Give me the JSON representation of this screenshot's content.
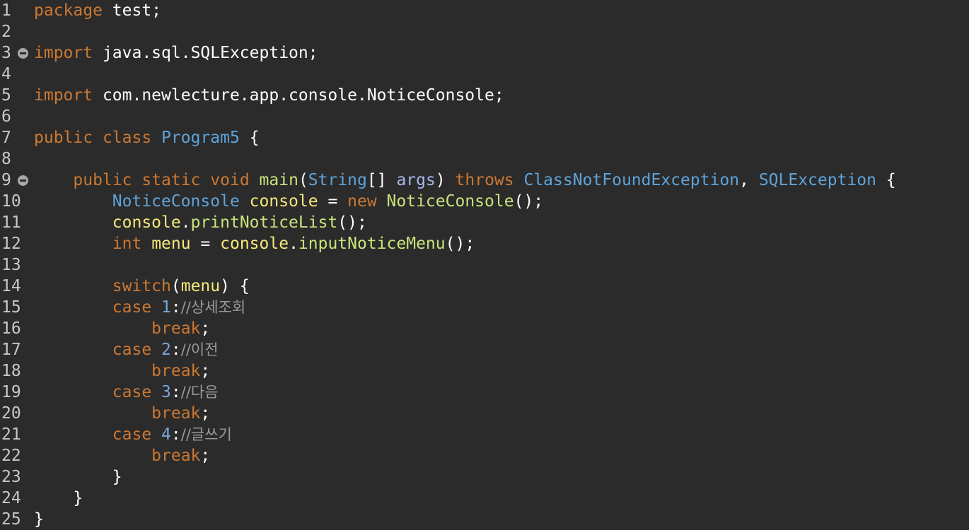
{
  "editor": {
    "lines": [
      {
        "num": "1",
        "fold": false,
        "tokens": [
          {
            "t": "package",
            "c": "kw"
          },
          {
            "t": " test;",
            "c": "plain"
          }
        ]
      },
      {
        "num": "2",
        "fold": false,
        "tokens": []
      },
      {
        "num": "3",
        "fold": true,
        "tokens": [
          {
            "t": "import",
            "c": "kw"
          },
          {
            "t": " java.sql.SQLException;",
            "c": "plain"
          }
        ]
      },
      {
        "num": "4",
        "fold": false,
        "tokens": []
      },
      {
        "num": "5",
        "fold": false,
        "tokens": [
          {
            "t": "import",
            "c": "kw"
          },
          {
            "t": " com.newlecture.app.console.NoticeConsole;",
            "c": "plain"
          }
        ]
      },
      {
        "num": "6",
        "fold": false,
        "tokens": []
      },
      {
        "num": "7",
        "fold": false,
        "tokens": [
          {
            "t": "public",
            "c": "kw"
          },
          {
            "t": " ",
            "c": "plain"
          },
          {
            "t": "class",
            "c": "kw"
          },
          {
            "t": " ",
            "c": "plain"
          },
          {
            "t": "Program5",
            "c": "type"
          },
          {
            "t": " {",
            "c": "plain"
          }
        ]
      },
      {
        "num": "8",
        "fold": false,
        "tokens": []
      },
      {
        "num": "9",
        "fold": true,
        "tokens": [
          {
            "t": "    ",
            "c": "plain"
          },
          {
            "t": "public",
            "c": "kw"
          },
          {
            "t": " ",
            "c": "plain"
          },
          {
            "t": "static",
            "c": "kw"
          },
          {
            "t": " ",
            "c": "plain"
          },
          {
            "t": "void",
            "c": "kw"
          },
          {
            "t": " ",
            "c": "plain"
          },
          {
            "t": "main",
            "c": "fn"
          },
          {
            "t": "(",
            "c": "plain"
          },
          {
            "t": "String",
            "c": "type"
          },
          {
            "t": "[] ",
            "c": "plain"
          },
          {
            "t": "args",
            "c": "param"
          },
          {
            "t": ") ",
            "c": "plain"
          },
          {
            "t": "throws",
            "c": "kw"
          },
          {
            "t": " ",
            "c": "plain"
          },
          {
            "t": "ClassNotFoundException",
            "c": "type"
          },
          {
            "t": ", ",
            "c": "plain"
          },
          {
            "t": "SQLException",
            "c": "type"
          },
          {
            "t": " {",
            "c": "plain"
          }
        ]
      },
      {
        "num": "10",
        "fold": false,
        "tokens": [
          {
            "t": "        ",
            "c": "plain"
          },
          {
            "t": "NoticeConsole",
            "c": "type"
          },
          {
            "t": " ",
            "c": "plain"
          },
          {
            "t": "console",
            "c": "var"
          },
          {
            "t": " = ",
            "c": "plain"
          },
          {
            "t": "new",
            "c": "kw"
          },
          {
            "t": " ",
            "c": "plain"
          },
          {
            "t": "NoticeConsole",
            "c": "fn"
          },
          {
            "t": "();",
            "c": "plain"
          }
        ]
      },
      {
        "num": "11",
        "fold": false,
        "tokens": [
          {
            "t": "        ",
            "c": "plain"
          },
          {
            "t": "console",
            "c": "var"
          },
          {
            "t": ".",
            "c": "plain"
          },
          {
            "t": "printNoticeList",
            "c": "fn"
          },
          {
            "t": "();",
            "c": "plain"
          }
        ]
      },
      {
        "num": "12",
        "fold": false,
        "tokens": [
          {
            "t": "        ",
            "c": "plain"
          },
          {
            "t": "int",
            "c": "kw"
          },
          {
            "t": " ",
            "c": "plain"
          },
          {
            "t": "menu",
            "c": "var"
          },
          {
            "t": " = ",
            "c": "plain"
          },
          {
            "t": "console",
            "c": "var"
          },
          {
            "t": ".",
            "c": "plain"
          },
          {
            "t": "inputNoticeMenu",
            "c": "fn"
          },
          {
            "t": "();",
            "c": "plain"
          }
        ]
      },
      {
        "num": "13",
        "fold": false,
        "tokens": []
      },
      {
        "num": "14",
        "fold": false,
        "tokens": [
          {
            "t": "        ",
            "c": "plain"
          },
          {
            "t": "switch",
            "c": "kw"
          },
          {
            "t": "(",
            "c": "plain"
          },
          {
            "t": "menu",
            "c": "var"
          },
          {
            "t": ") {",
            "c": "plain"
          }
        ]
      },
      {
        "num": "15",
        "fold": false,
        "tokens": [
          {
            "t": "        ",
            "c": "plain"
          },
          {
            "t": "case",
            "c": "kw"
          },
          {
            "t": " ",
            "c": "plain"
          },
          {
            "t": "1",
            "c": "num"
          },
          {
            "t": ":",
            "c": "plain"
          },
          {
            "t": "//상세조회",
            "c": "comment"
          }
        ]
      },
      {
        "num": "16",
        "fold": false,
        "tokens": [
          {
            "t": "            ",
            "c": "plain"
          },
          {
            "t": "break",
            "c": "kw"
          },
          {
            "t": ";",
            "c": "plain"
          }
        ]
      },
      {
        "num": "17",
        "fold": false,
        "tokens": [
          {
            "t": "        ",
            "c": "plain"
          },
          {
            "t": "case",
            "c": "kw"
          },
          {
            "t": " ",
            "c": "plain"
          },
          {
            "t": "2",
            "c": "num"
          },
          {
            "t": ":",
            "c": "plain"
          },
          {
            "t": "//이전",
            "c": "comment"
          }
        ]
      },
      {
        "num": "18",
        "fold": false,
        "tokens": [
          {
            "t": "            ",
            "c": "plain"
          },
          {
            "t": "break",
            "c": "kw"
          },
          {
            "t": ";",
            "c": "plain"
          }
        ]
      },
      {
        "num": "19",
        "fold": false,
        "tokens": [
          {
            "t": "        ",
            "c": "plain"
          },
          {
            "t": "case",
            "c": "kw"
          },
          {
            "t": " ",
            "c": "plain"
          },
          {
            "t": "3",
            "c": "num"
          },
          {
            "t": ":",
            "c": "plain"
          },
          {
            "t": "//다음",
            "c": "comment"
          }
        ]
      },
      {
        "num": "20",
        "fold": false,
        "tokens": [
          {
            "t": "            ",
            "c": "plain"
          },
          {
            "t": "break",
            "c": "kw"
          },
          {
            "t": ";",
            "c": "plain"
          }
        ]
      },
      {
        "num": "21",
        "fold": false,
        "tokens": [
          {
            "t": "        ",
            "c": "plain"
          },
          {
            "t": "case",
            "c": "kw"
          },
          {
            "t": " ",
            "c": "plain"
          },
          {
            "t": "4",
            "c": "num"
          },
          {
            "t": ":",
            "c": "plain"
          },
          {
            "t": "//글쓰기",
            "c": "comment"
          }
        ]
      },
      {
        "num": "22",
        "fold": false,
        "tokens": [
          {
            "t": "            ",
            "c": "plain"
          },
          {
            "t": "break",
            "c": "kw"
          },
          {
            "t": ";",
            "c": "plain"
          }
        ]
      },
      {
        "num": "23",
        "fold": false,
        "tokens": [
          {
            "t": "        ",
            "c": "plain"
          },
          {
            "t": "}",
            "c": "plain"
          }
        ]
      },
      {
        "num": "24",
        "fold": false,
        "tokens": [
          {
            "t": "    ",
            "c": "plain"
          },
          {
            "t": "}",
            "c": "plain"
          }
        ]
      },
      {
        "num": "25",
        "fold": false,
        "tokens": [
          {
            "t": "}",
            "c": "plain"
          }
        ]
      }
    ]
  },
  "colors": {
    "background": "#2b2b2b",
    "keyword": "#cc7832",
    "type": "#5fa3d9",
    "variable": "#f5e97a",
    "function": "#c9e37c",
    "number": "#7aa6da",
    "comment": "#9a9a9a",
    "plain": "#ffffff"
  }
}
